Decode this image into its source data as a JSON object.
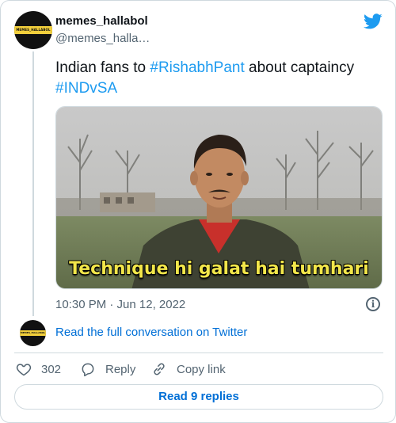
{
  "author": {
    "display_name": "memes_hallabol",
    "handle": "@memes_halla…",
    "avatar_text": "MEMES_HALLABOL",
    "avatar_colors": {
      "background": "#111111",
      "band": "#f2cf3c"
    }
  },
  "icons": {
    "brand": "twitter-bird-icon",
    "info": "info-icon",
    "like": "heart-icon",
    "reply": "reply-bubble-icon",
    "copy": "link-icon"
  },
  "tweet": {
    "text_intro": "Indian fans to ",
    "hashtag_1": "#RishabhPant",
    "text_middle": "  about captaincy",
    "hashtag_2": "#INDvSA",
    "media_caption": "Technique hi galat hai tumhari",
    "timestamp": "10:30 PM · Jun 12, 2022"
  },
  "conversation_link": "Read the full conversation on Twitter",
  "actions": {
    "like_count": "302",
    "reply_label": "Reply",
    "copy_label": "Copy link"
  },
  "replies_button": "Read 9 replies",
  "colors": {
    "link": "#1d9bf0",
    "link_dark": "#006fd6",
    "muted": "#536471",
    "border": "#cfd9de",
    "caption": "#f2e64a"
  }
}
